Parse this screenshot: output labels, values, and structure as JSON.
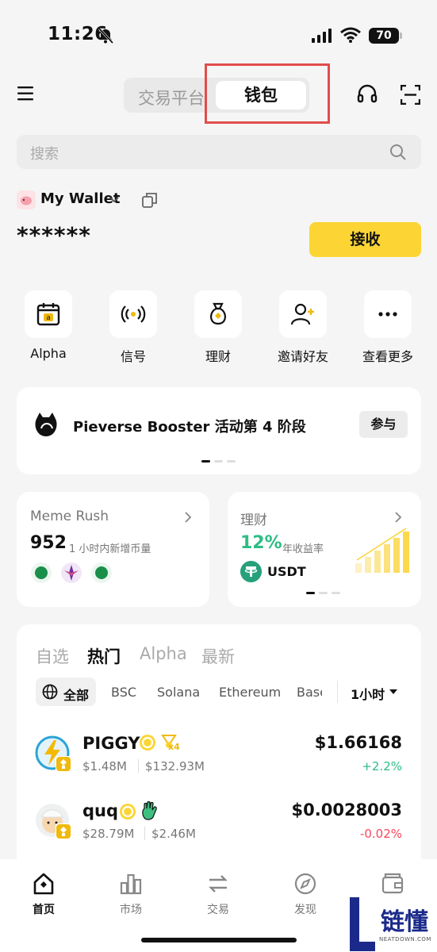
{
  "status": {
    "time": "11:26",
    "battery": "70"
  },
  "header": {
    "tab_exchange": "交易平台",
    "tab_wallet": "钱包"
  },
  "search": {
    "placeholder": "搜索"
  },
  "wallet": {
    "name": "My Wallet",
    "balance": "******",
    "receive_label": "接收"
  },
  "quick_actions": [
    {
      "label": "Alpha",
      "icon": "alpha-calendar-icon"
    },
    {
      "label": "信号",
      "icon": "signal-broadcast-icon"
    },
    {
      "label": "理财",
      "icon": "money-bag-icon"
    },
    {
      "label": "邀请好友",
      "icon": "invite-user-icon"
    },
    {
      "label": "查看更多",
      "icon": "more-icon"
    }
  ],
  "banner": {
    "text": "Pieverse Booster 活动第 4 阶段",
    "button": "参与"
  },
  "meme_card": {
    "title": "Meme Rush",
    "count": "952",
    "subtitle": "1 小时内新增币量"
  },
  "earn_card": {
    "title": "理财",
    "apy": "12%",
    "apy_label": "年收益率",
    "asset": "USDT"
  },
  "market": {
    "tabs": [
      "自选",
      "热门",
      "Alpha",
      "最新"
    ],
    "active_tab": 1,
    "chains": [
      "全部",
      "BSC",
      "Solana",
      "Ethereum",
      "Base"
    ],
    "interval": "1小时",
    "coins": [
      {
        "name": "PIGGY",
        "mcap": "$1.48M",
        "vol": "$132.93M",
        "price": "$1.66168",
        "change": "+2.2%",
        "multiplier": "x4"
      },
      {
        "name": "quq",
        "mcap": "$28.79M",
        "vol": "$2.46M",
        "price": "$0.0028003",
        "change": "-0.02%"
      }
    ]
  },
  "bottom_nav": [
    "首页",
    "市场",
    "交易",
    "发现",
    "钱包"
  ],
  "watermark": {
    "text": "链懂",
    "sub": "NEATDOWN.COM"
  },
  "colors": {
    "accent": "#fcd535",
    "up": "#2ebd85",
    "down": "#f6465d",
    "highlight": "#e24c4c"
  }
}
